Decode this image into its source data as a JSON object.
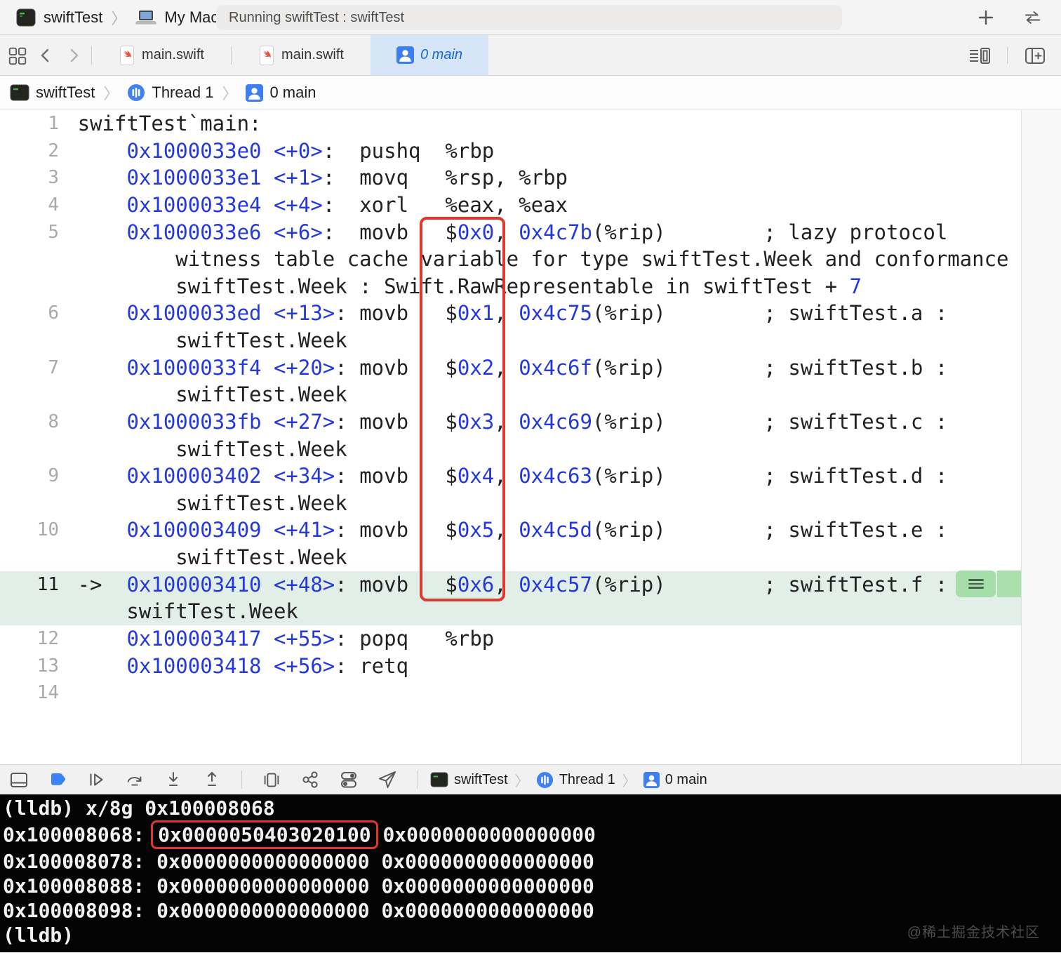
{
  "toolbar": {
    "project": "swiftTest",
    "destination": "My Mac",
    "status": "Running swiftTest : swiftTest",
    "icons": [
      "app-icon",
      "laptop-icon",
      "plus-icon",
      "swap-arrows-icon"
    ]
  },
  "tabbar": {
    "tab1": "main.swift",
    "tab2": "main.swift",
    "tab3": "0 main",
    "icons": [
      "tab-grid-icon",
      "back-chevron-icon",
      "forward-chevron-icon",
      "swift-file-icon",
      "person-icon",
      "editor-options-icon",
      "add-editor-icon"
    ]
  },
  "jumpbar": {
    "item1": "swiftTest",
    "item2": "Thread 1",
    "item3": "0 main"
  },
  "editor": {
    "rows": [
      {
        "n": "1",
        "hl": false,
        "seg": [
          [
            "p",
            "swiftTest`main:"
          ]
        ]
      },
      {
        "n": "2",
        "hl": false,
        "seg": [
          [
            "p",
            "    "
          ],
          [
            "a",
            "0x1000033e0"
          ],
          [
            "p",
            " "
          ],
          [
            "a",
            "<+0>"
          ],
          [
            "p",
            ":  pushq  %rbp"
          ]
        ]
      },
      {
        "n": "3",
        "hl": false,
        "seg": [
          [
            "p",
            "    "
          ],
          [
            "a",
            "0x1000033e1"
          ],
          [
            "p",
            " "
          ],
          [
            "a",
            "<+1>"
          ],
          [
            "p",
            ":  movq   %rsp, %rbp"
          ]
        ]
      },
      {
        "n": "4",
        "hl": false,
        "seg": [
          [
            "p",
            "    "
          ],
          [
            "a",
            "0x1000033e4"
          ],
          [
            "p",
            " "
          ],
          [
            "a",
            "<+4>"
          ],
          [
            "p",
            ":  xorl   %eax, %eax"
          ]
        ]
      },
      {
        "n": "5",
        "hl": false,
        "seg": [
          [
            "p",
            "    "
          ],
          [
            "a",
            "0x1000033e6"
          ],
          [
            "p",
            " "
          ],
          [
            "a",
            "<+6>"
          ],
          [
            "p",
            ":  movb   $"
          ],
          [
            "a",
            "0x0"
          ],
          [
            "p",
            ", "
          ],
          [
            "a",
            "0x4c7b"
          ],
          [
            "p",
            "(%rip)        ; lazy protocol"
          ]
        ]
      },
      {
        "n": "",
        "hl": false,
        "seg": [
          [
            "p",
            "        witness table cache variable for type swiftTest.Week and conformance"
          ]
        ]
      },
      {
        "n": "",
        "hl": false,
        "seg": [
          [
            "p",
            "        swiftTest.Week : Swift.RawRepresentable in swiftTest + "
          ],
          [
            "a",
            "7"
          ]
        ]
      },
      {
        "n": "6",
        "hl": false,
        "seg": [
          [
            "p",
            "    "
          ],
          [
            "a",
            "0x1000033ed"
          ],
          [
            "p",
            " "
          ],
          [
            "a",
            "<+13>"
          ],
          [
            "p",
            ": movb   $"
          ],
          [
            "a",
            "0x1"
          ],
          [
            "p",
            ", "
          ],
          [
            "a",
            "0x4c75"
          ],
          [
            "p",
            "(%rip)        ; swiftTest.a :"
          ]
        ]
      },
      {
        "n": "",
        "hl": false,
        "seg": [
          [
            "p",
            "        swiftTest.Week"
          ]
        ]
      },
      {
        "n": "7",
        "hl": false,
        "seg": [
          [
            "p",
            "    "
          ],
          [
            "a",
            "0x1000033f4"
          ],
          [
            "p",
            " "
          ],
          [
            "a",
            "<+20>"
          ],
          [
            "p",
            ": movb   $"
          ],
          [
            "a",
            "0x2"
          ],
          [
            "p",
            ", "
          ],
          [
            "a",
            "0x4c6f"
          ],
          [
            "p",
            "(%rip)        ; swiftTest.b :"
          ]
        ]
      },
      {
        "n": "",
        "hl": false,
        "seg": [
          [
            "p",
            "        swiftTest.Week"
          ]
        ]
      },
      {
        "n": "8",
        "hl": false,
        "seg": [
          [
            "p",
            "    "
          ],
          [
            "a",
            "0x1000033fb"
          ],
          [
            "p",
            " "
          ],
          [
            "a",
            "<+27>"
          ],
          [
            "p",
            ": movb   $"
          ],
          [
            "a",
            "0x3"
          ],
          [
            "p",
            ", "
          ],
          [
            "a",
            "0x4c69"
          ],
          [
            "p",
            "(%rip)        ; swiftTest.c :"
          ]
        ]
      },
      {
        "n": "",
        "hl": false,
        "seg": [
          [
            "p",
            "        swiftTest.Week"
          ]
        ]
      },
      {
        "n": "9",
        "hl": false,
        "seg": [
          [
            "p",
            "    "
          ],
          [
            "a",
            "0x100003402"
          ],
          [
            "p",
            " "
          ],
          [
            "a",
            "<+34>"
          ],
          [
            "p",
            ": movb   $"
          ],
          [
            "a",
            "0x4"
          ],
          [
            "p",
            ", "
          ],
          [
            "a",
            "0x4c63"
          ],
          [
            "p",
            "(%rip)        ; swiftTest.d :"
          ]
        ]
      },
      {
        "n": "",
        "hl": false,
        "seg": [
          [
            "p",
            "        swiftTest.Week"
          ]
        ]
      },
      {
        "n": "10",
        "hl": false,
        "seg": [
          [
            "p",
            "    "
          ],
          [
            "a",
            "0x100003409"
          ],
          [
            "p",
            " "
          ],
          [
            "a",
            "<+41>"
          ],
          [
            "p",
            ": movb   $"
          ],
          [
            "a",
            "0x5"
          ],
          [
            "p",
            ", "
          ],
          [
            "a",
            "0x4c5d"
          ],
          [
            "p",
            "(%rip)        ; swiftTest.e :"
          ]
        ]
      },
      {
        "n": "",
        "hl": false,
        "seg": [
          [
            "p",
            "        swiftTest.Week"
          ]
        ]
      },
      {
        "n": "11",
        "hl": true,
        "seg": [
          [
            "p",
            "->  "
          ],
          [
            "a",
            "0x100003410"
          ],
          [
            "p",
            " "
          ],
          [
            "a",
            "<+48>"
          ],
          [
            "p",
            ": movb   $"
          ],
          [
            "a",
            "0x6"
          ],
          [
            "p",
            ", "
          ],
          [
            "a",
            "0x4c57"
          ],
          [
            "p",
            "(%rip)        ; swiftTest.f :"
          ]
        ]
      },
      {
        "n": "",
        "hl": true,
        "seg": [
          [
            "p",
            "    swiftTest.Week"
          ]
        ]
      },
      {
        "n": "12",
        "hl": false,
        "seg": [
          [
            "p",
            "    "
          ],
          [
            "a",
            "0x100003417"
          ],
          [
            "p",
            " "
          ],
          [
            "a",
            "<+55>"
          ],
          [
            "p",
            ": popq   %rbp"
          ]
        ]
      },
      {
        "n": "13",
        "hl": false,
        "seg": [
          [
            "p",
            "    "
          ],
          [
            "a",
            "0x100003418"
          ],
          [
            "p",
            " "
          ],
          [
            "a",
            "<+56>"
          ],
          [
            "p",
            ": retq"
          ]
        ]
      },
      {
        "n": "14",
        "hl": false,
        "seg": []
      }
    ]
  },
  "debugbar": {
    "item1": "swiftTest",
    "item2": "Thread 1",
    "item3": "0 main",
    "icons": [
      "hide-debug-area-icon",
      "breakpoints-icon",
      "continue-icon",
      "step-over-icon",
      "step-into-icon",
      "step-out-icon",
      "view-hierarchy-icon",
      "memory-graph-icon",
      "environment-overrides-icon",
      "simulate-location-icon"
    ]
  },
  "console": {
    "line1": "(lldb) x/8g 0x100008068",
    "row1_prefix": "0x100008068: ",
    "row1_boxed": "0x0000050403020100",
    "row1_rest": " 0x0000000000000000",
    "rows": [
      "0x100008078: 0x0000000000000000 0x0000000000000000",
      "0x100008088: 0x0000000000000000 0x0000000000000000",
      "0x100008098: 0x0000000000000000 0x0000000000000000"
    ],
    "prompt": "(lldb)",
    "watermark": "@稀土掘金技术社区"
  },
  "colors": {
    "code_blue": "#2438df",
    "annotation_red": "#e2382b",
    "highlight_green": "#e2efe9",
    "tab_selected_blue": "#d7e5f8",
    "tab_text_blue": "#1767e0",
    "breakpoint_blue": "#3b82f7"
  }
}
